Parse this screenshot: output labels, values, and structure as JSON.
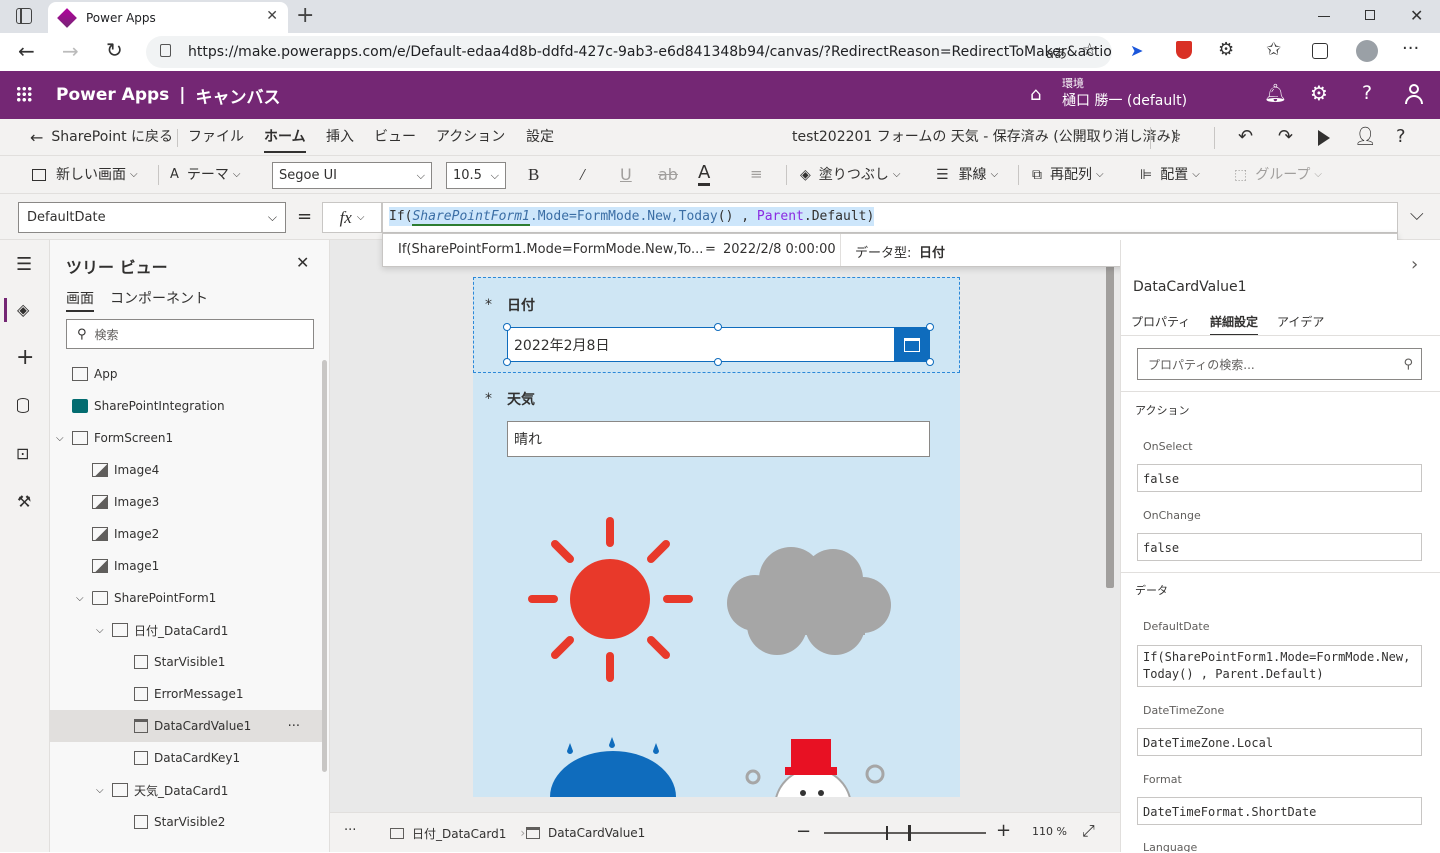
{
  "browser": {
    "tab_title": "Power Apps",
    "url": "https://make.powerapps.com/e/Default-edaa4d8b-ddfd-427c-9ab3-e6d841348b94/canvas/?RedirectReason=RedirectToMaker&action..."
  },
  "header": {
    "app_name": "Power Apps",
    "section": "キャンバス",
    "env_label": "環境",
    "env_name": "樋口 勝一 (default)",
    "accent": "#742774"
  },
  "command_bar": {
    "back": "SharePoint に戻る",
    "menus": [
      "ファイル",
      "ホーム",
      "挿入",
      "ビュー",
      "アクション",
      "設定"
    ],
    "active_menu": "ホーム",
    "doc_title": "test202201 フォームの 天気 - 保存済み (公開取り消し済み)"
  },
  "ribbon": {
    "new_screen": "新しい画面",
    "theme": "テーマ",
    "font": "Segoe UI",
    "font_size": "10.5",
    "fill": "塗りつぶし",
    "border": "罫線",
    "reorder": "再配列",
    "align": "配置",
    "group": "グループ"
  },
  "formula_bar": {
    "property": "DefaultDate",
    "fx": "fx",
    "formula_parts": [
      "If(",
      "SharePointForm1",
      ".Mode=",
      "FormMode",
      ".New,",
      "Today",
      "() , ",
      "Parent",
      ".Default)"
    ],
    "suggest_expr": "If(SharePointForm1.Mode=FormMode.New,To...",
    "suggest_eq": "=",
    "suggest_value": "2022/2/8 0:00:00",
    "suggest_type_label": "データ型:",
    "suggest_type": "日付"
  },
  "tree": {
    "title": "ツリー ビュー",
    "tabs": [
      "画面",
      "コンポーネント"
    ],
    "search_placeholder": "検索",
    "items": [
      "App",
      "SharePointIntegration",
      "FormScreen1",
      "Image4",
      "Image3",
      "Image2",
      "Image1",
      "SharePointForm1",
      "日付_DataCard1",
      "StarVisible1",
      "ErrorMessage1",
      "DataCardValue1",
      "DataCardKey1",
      "天気_DataCard1",
      "StarVisible2"
    ],
    "more": "···"
  },
  "canvas": {
    "card1_star": "*",
    "card1_label": "日付",
    "card1_value": "2022年2月8日",
    "card2_star": "*",
    "card2_label": "天気",
    "card2_value": "晴れ",
    "sun_color": "#e8392a",
    "cloud_color": "#a6a6a6",
    "umbrella_color": "#0f6cbd",
    "snowman_hat_color": "#e81123"
  },
  "canvas_footer": {
    "more": "···",
    "crumb1": "日付_DataCard1",
    "crumb2": "DataCardValue1",
    "zoom": "110 %"
  },
  "properties": {
    "control_name": "DataCardValue1",
    "tabs": [
      "プロパティ",
      "詳細設定",
      "アイデア"
    ],
    "active_tab": "詳細設定",
    "search_placeholder": "プロパティの検索...",
    "section_action": "アクション",
    "onselect_label": "OnSelect",
    "onselect_value": "false",
    "onchange_label": "OnChange",
    "onchange_value": "false",
    "section_data": "データ",
    "defaultdate_label": "DefaultDate",
    "defaultdate_value": "If(SharePointForm1.Mode=FormMode.New,Today() , Parent.Default)",
    "tz_label": "DateTimeZone",
    "tz_value": "DateTimeZone.Local",
    "format_label": "Format",
    "format_value": "DateTimeFormat.ShortDate",
    "language_label": "Language"
  }
}
